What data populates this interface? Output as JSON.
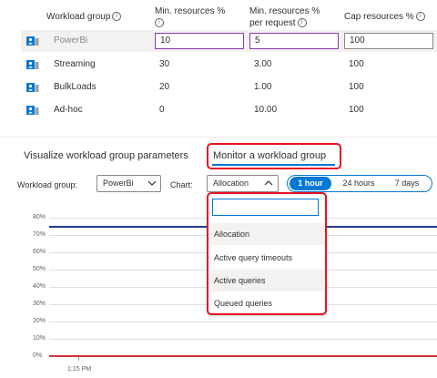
{
  "table": {
    "headers": {
      "workload_group": "Workload group",
      "min_resources_line1": "Min. resources %",
      "min_per_request_line1": "Min. resources %",
      "min_per_request_line2": "per request",
      "cap_resources": "Cap resources %"
    },
    "rows": [
      {
        "name": "PowerBi",
        "min": "10",
        "per_request": "5",
        "cap": "100"
      },
      {
        "name": "Streaming",
        "min": "30",
        "per_request": "3.00",
        "cap": "100"
      },
      {
        "name": "BulkLoads",
        "min": "20",
        "per_request": "1.00",
        "cap": "100"
      },
      {
        "name": "Ad-hoc",
        "min": "0",
        "per_request": "10.00",
        "cap": "100"
      }
    ]
  },
  "tabs": {
    "visualize": "Visualize workload group parameters",
    "monitor": "Monitor a workload group"
  },
  "filters": {
    "workload_group_label": "Workload group:",
    "workload_group_value": "PowerBi",
    "chart_label": "Chart:",
    "chart_value": "Allocation",
    "time_options": [
      "1 hour",
      "24 hours",
      "7 days"
    ],
    "time_selected": "1 hour"
  },
  "dropdown": {
    "search_value": "",
    "options": [
      "Allocation",
      "Active query timeouts",
      "Active queries",
      "Queued queries"
    ],
    "highlighted": [
      "Allocation",
      "Active queries"
    ]
  },
  "chart_data": {
    "type": "line",
    "ylim": [
      0,
      80
    ],
    "yticks": [
      "80%",
      "70%",
      "60%",
      "50%",
      "40%",
      "30%",
      "20%",
      "10%",
      "0%"
    ],
    "xticks": [
      "1:15 PM"
    ],
    "series": [
      {
        "color": "#243a8f",
        "y": 75
      },
      {
        "color": "#d13438",
        "y": 0
      }
    ]
  },
  "colors": {
    "accent": "#0078d4",
    "highlight_box": "#e81123",
    "input_focus": "#8a3aa8"
  }
}
